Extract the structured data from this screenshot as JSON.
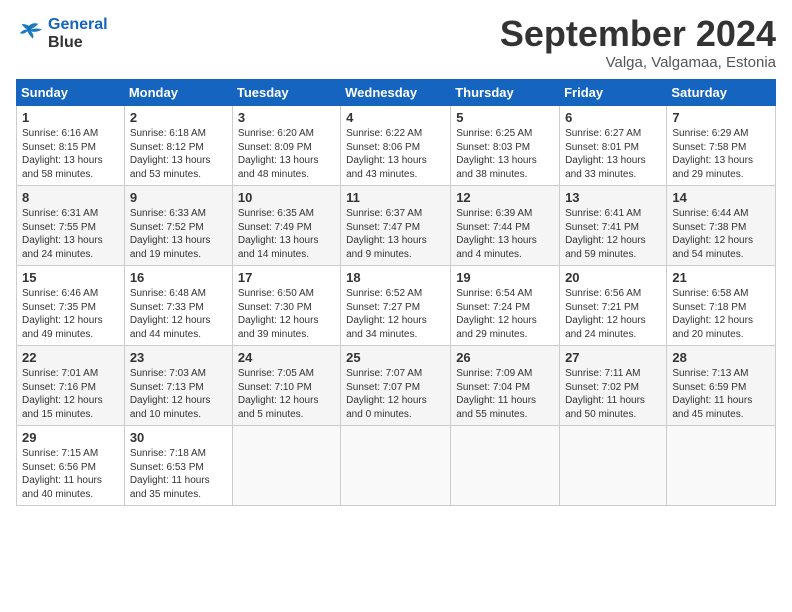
{
  "logo": {
    "line1": "General",
    "line2": "Blue"
  },
  "title": "September 2024",
  "subtitle": "Valga, Valgamaa, Estonia",
  "weekdays": [
    "Sunday",
    "Monday",
    "Tuesday",
    "Wednesday",
    "Thursday",
    "Friday",
    "Saturday"
  ],
  "weeks": [
    [
      {
        "day": "1",
        "info": "Sunrise: 6:16 AM\nSunset: 8:15 PM\nDaylight: 13 hours\nand 58 minutes."
      },
      {
        "day": "2",
        "info": "Sunrise: 6:18 AM\nSunset: 8:12 PM\nDaylight: 13 hours\nand 53 minutes."
      },
      {
        "day": "3",
        "info": "Sunrise: 6:20 AM\nSunset: 8:09 PM\nDaylight: 13 hours\nand 48 minutes."
      },
      {
        "day": "4",
        "info": "Sunrise: 6:22 AM\nSunset: 8:06 PM\nDaylight: 13 hours\nand 43 minutes."
      },
      {
        "day": "5",
        "info": "Sunrise: 6:25 AM\nSunset: 8:03 PM\nDaylight: 13 hours\nand 38 minutes."
      },
      {
        "day": "6",
        "info": "Sunrise: 6:27 AM\nSunset: 8:01 PM\nDaylight: 13 hours\nand 33 minutes."
      },
      {
        "day": "7",
        "info": "Sunrise: 6:29 AM\nSunset: 7:58 PM\nDaylight: 13 hours\nand 29 minutes."
      }
    ],
    [
      {
        "day": "8",
        "info": "Sunrise: 6:31 AM\nSunset: 7:55 PM\nDaylight: 13 hours\nand 24 minutes."
      },
      {
        "day": "9",
        "info": "Sunrise: 6:33 AM\nSunset: 7:52 PM\nDaylight: 13 hours\nand 19 minutes."
      },
      {
        "day": "10",
        "info": "Sunrise: 6:35 AM\nSunset: 7:49 PM\nDaylight: 13 hours\nand 14 minutes."
      },
      {
        "day": "11",
        "info": "Sunrise: 6:37 AM\nSunset: 7:47 PM\nDaylight: 13 hours\nand 9 minutes."
      },
      {
        "day": "12",
        "info": "Sunrise: 6:39 AM\nSunset: 7:44 PM\nDaylight: 13 hours\nand 4 minutes."
      },
      {
        "day": "13",
        "info": "Sunrise: 6:41 AM\nSunset: 7:41 PM\nDaylight: 12 hours\nand 59 minutes."
      },
      {
        "day": "14",
        "info": "Sunrise: 6:44 AM\nSunset: 7:38 PM\nDaylight: 12 hours\nand 54 minutes."
      }
    ],
    [
      {
        "day": "15",
        "info": "Sunrise: 6:46 AM\nSunset: 7:35 PM\nDaylight: 12 hours\nand 49 minutes."
      },
      {
        "day": "16",
        "info": "Sunrise: 6:48 AM\nSunset: 7:33 PM\nDaylight: 12 hours\nand 44 minutes."
      },
      {
        "day": "17",
        "info": "Sunrise: 6:50 AM\nSunset: 7:30 PM\nDaylight: 12 hours\nand 39 minutes."
      },
      {
        "day": "18",
        "info": "Sunrise: 6:52 AM\nSunset: 7:27 PM\nDaylight: 12 hours\nand 34 minutes."
      },
      {
        "day": "19",
        "info": "Sunrise: 6:54 AM\nSunset: 7:24 PM\nDaylight: 12 hours\nand 29 minutes."
      },
      {
        "day": "20",
        "info": "Sunrise: 6:56 AM\nSunset: 7:21 PM\nDaylight: 12 hours\nand 24 minutes."
      },
      {
        "day": "21",
        "info": "Sunrise: 6:58 AM\nSunset: 7:18 PM\nDaylight: 12 hours\nand 20 minutes."
      }
    ],
    [
      {
        "day": "22",
        "info": "Sunrise: 7:01 AM\nSunset: 7:16 PM\nDaylight: 12 hours\nand 15 minutes."
      },
      {
        "day": "23",
        "info": "Sunrise: 7:03 AM\nSunset: 7:13 PM\nDaylight: 12 hours\nand 10 minutes."
      },
      {
        "day": "24",
        "info": "Sunrise: 7:05 AM\nSunset: 7:10 PM\nDaylight: 12 hours\nand 5 minutes."
      },
      {
        "day": "25",
        "info": "Sunrise: 7:07 AM\nSunset: 7:07 PM\nDaylight: 12 hours\nand 0 minutes."
      },
      {
        "day": "26",
        "info": "Sunrise: 7:09 AM\nSunset: 7:04 PM\nDaylight: 11 hours\nand 55 minutes."
      },
      {
        "day": "27",
        "info": "Sunrise: 7:11 AM\nSunset: 7:02 PM\nDaylight: 11 hours\nand 50 minutes."
      },
      {
        "day": "28",
        "info": "Sunrise: 7:13 AM\nSunset: 6:59 PM\nDaylight: 11 hours\nand 45 minutes."
      }
    ],
    [
      {
        "day": "29",
        "info": "Sunrise: 7:15 AM\nSunset: 6:56 PM\nDaylight: 11 hours\nand 40 minutes."
      },
      {
        "day": "30",
        "info": "Sunrise: 7:18 AM\nSunset: 6:53 PM\nDaylight: 11 hours\nand 35 minutes."
      },
      {
        "day": "",
        "info": ""
      },
      {
        "day": "",
        "info": ""
      },
      {
        "day": "",
        "info": ""
      },
      {
        "day": "",
        "info": ""
      },
      {
        "day": "",
        "info": ""
      }
    ]
  ]
}
